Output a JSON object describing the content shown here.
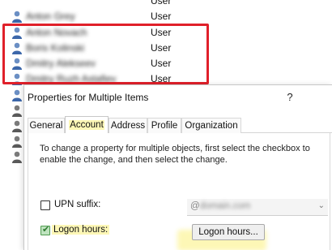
{
  "user_list": {
    "rows": [
      {
        "name": "Anton Grey",
        "type": "User",
        "blurred": true
      },
      {
        "name": "Anton Novach",
        "type": "User",
        "blurred": true
      },
      {
        "name": "Boris Kolinski",
        "type": "User",
        "blurred": true
      },
      {
        "name": "Dmitry Alekseev",
        "type": "User",
        "blurred": true
      },
      {
        "name": "Dmitry Ruzh Astafiev",
        "type": "User",
        "blurred": true
      }
    ],
    "highlight_color": "#e0202a"
  },
  "dialog": {
    "title": "Properties for Multiple Items",
    "help_label": "?",
    "close_label": "✕",
    "tabs": [
      {
        "label": "General",
        "active": false
      },
      {
        "label": "Account",
        "active": true
      },
      {
        "label": "Address",
        "active": false
      },
      {
        "label": "Profile",
        "active": false
      },
      {
        "label": "Organization",
        "active": false
      }
    ],
    "account": {
      "hint": "To change a property for multiple objects, first select the checkbox to enable the change, and then select the change.",
      "upn_suffix_label": "UPN suffix:",
      "upn_suffix_checked": false,
      "upn_value": "@",
      "upn_value_blurred": "domain.com",
      "logon_hours_label": "Logon hours:",
      "logon_hours_checked": true,
      "logon_hours_button": "Logon hours..."
    }
  }
}
